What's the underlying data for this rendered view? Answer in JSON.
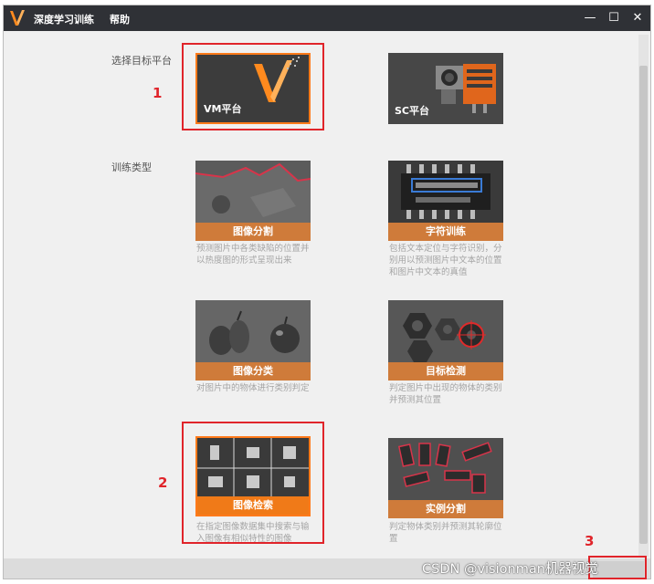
{
  "titlebar": {
    "app_title": "深度学习训练",
    "menu_help": "帮助",
    "minimize_glyph": "—",
    "maximize_glyph": "☐",
    "close_glyph": "✕",
    "logo_icon": "v-logo-icon"
  },
  "sections": {
    "platform_label": "选择目标平台",
    "type_label": "训练类型"
  },
  "platforms": [
    {
      "label": "VM平台",
      "selected": true
    },
    {
      "label": "SC平台",
      "selected": false
    }
  ],
  "training_types": [
    {
      "label": "图像分割",
      "desc": "预测图片中各类缺陷的位置并以热度图的形式呈现出来"
    },
    {
      "label": "字符训练",
      "desc": "包括文本定位与字符识别，分别用以预测图片中文本的位置和图片中文本的真值"
    },
    {
      "label": "图像分类",
      "desc": "对图片中的物体进行类别判定"
    },
    {
      "label": "目标检测",
      "desc": "判定图片中出现的物体的类别并预测其位置"
    },
    {
      "label": "图像检索",
      "desc": "在指定图像数据集中搜索与输入图像有相似特性的图像",
      "selected": true
    },
    {
      "label": "实例分割",
      "desc": "判定物体类别并预测其轮廓位置"
    }
  ],
  "annotations": [
    "1",
    "2",
    "3"
  ],
  "watermark": "CSDN @visionman机器视觉",
  "colors": {
    "accent": "#ff7a1a",
    "tile_band": "#cf7b3a",
    "annotation_red": "#e0242a",
    "titlebar": "#2f3136"
  }
}
